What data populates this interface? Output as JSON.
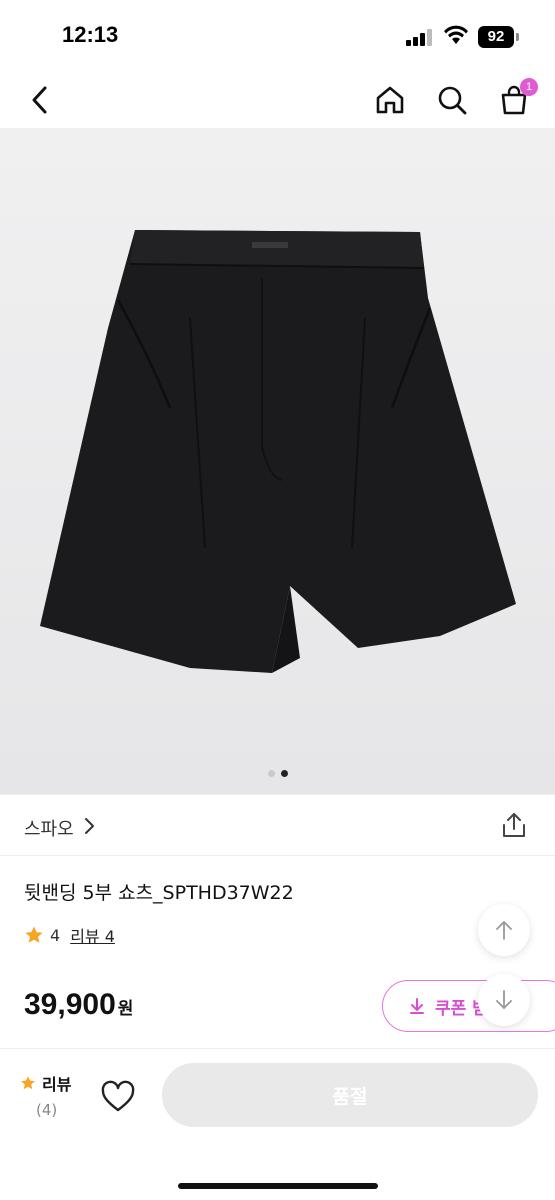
{
  "status_bar": {
    "time": "12:13",
    "battery": "92"
  },
  "nav": {
    "back_icon": "chevron-left-icon",
    "home_icon": "home-icon",
    "search_icon": "search-icon",
    "cart_icon": "shopping-bag-icon",
    "cart_count": "1"
  },
  "gallery": {
    "image": "black-shorts-photo",
    "pages": 2,
    "active_page": 2
  },
  "brand": {
    "name": "스파오",
    "chevron": "›"
  },
  "product": {
    "title": "뒷밴딩 5부 쇼츠_SPTHD37W22",
    "rating": "4",
    "review_link": "리뷰 4",
    "price": "39,900",
    "currency": "원"
  },
  "coupon": {
    "label": "쿠폰 받",
    "icon": "download-icon"
  },
  "scroll": {
    "up_icon": "arrow-up-icon",
    "down_icon": "arrow-down-icon"
  },
  "bottom_bar": {
    "review_label": "리뷰",
    "review_count": "(4)",
    "wishlist_icon": "heart-icon",
    "soldout_label": "품절"
  },
  "colors": {
    "accent": "#e05bd3",
    "star": "#f5a623",
    "disabled": "#e9e9ea"
  }
}
